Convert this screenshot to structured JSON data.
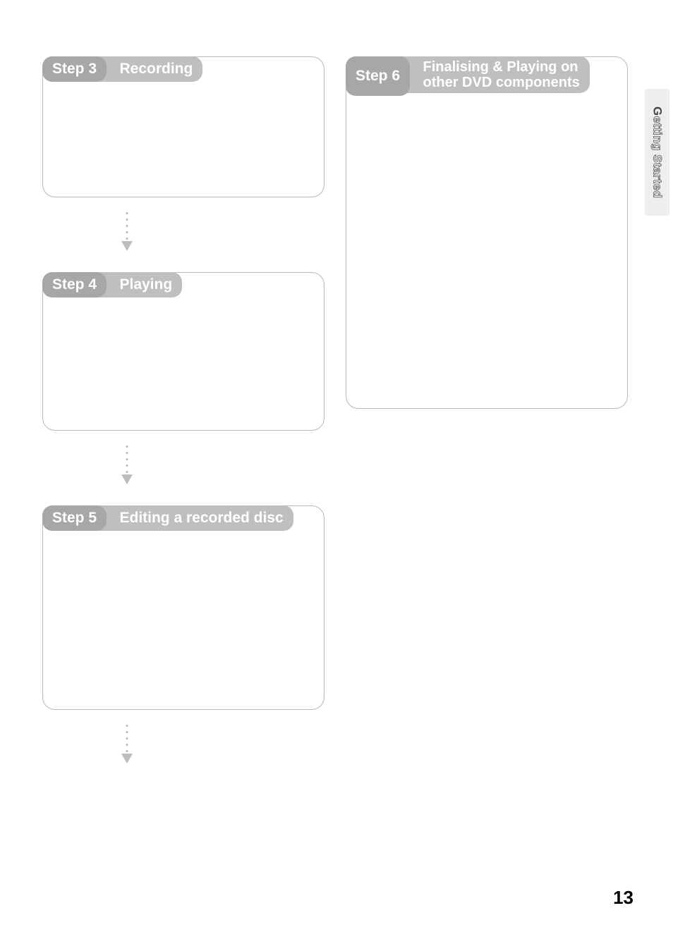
{
  "steps": {
    "s3": {
      "num": "Step 3",
      "title": "Recording"
    },
    "s4": {
      "num": "Step 4",
      "title": "Playing"
    },
    "s5": {
      "num": "Step 5",
      "title": "Editing a recorded disc"
    },
    "s6": {
      "num": "Step 6",
      "title": "Finalising & Playing on\nother DVD components"
    }
  },
  "sideTab": {
    "firstLetter": "G",
    "rest": "etting Started"
  },
  "pageNumber": "13"
}
